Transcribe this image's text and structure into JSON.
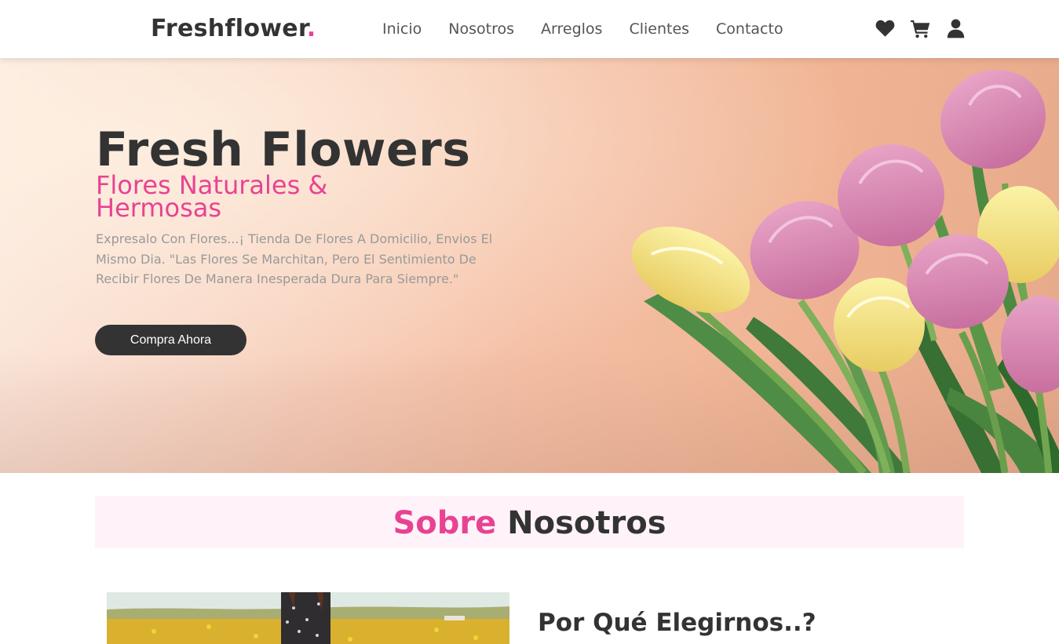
{
  "brand": {
    "name": "Freshflower",
    "dot": ".",
    "accent": "#e84393"
  },
  "nav": [
    {
      "label": "Inicio"
    },
    {
      "label": "Nosotros"
    },
    {
      "label": "Arreglos"
    },
    {
      "label": "Clientes"
    },
    {
      "label": "Contacto"
    }
  ],
  "header_icons": [
    "heart-icon",
    "cart-icon",
    "user-icon"
  ],
  "hero": {
    "title": "Fresh Flowers",
    "subtitle": "Flores Naturales & Hermosas",
    "description": "Expresalo Con Flores...¡ Tienda De Flores A Domicilio, Envios El Mismo Dia. \"Las Flores Se Marchitan, Pero El Sentimiento De Recibir Flores De Manera Inesperada Dura Para Siempre.\"",
    "button": "Compra Ahora"
  },
  "about": {
    "title_accent": "Sobre",
    "title_rest": "Nosotros",
    "why_heading": "Por Qué Elegirnos..?"
  }
}
